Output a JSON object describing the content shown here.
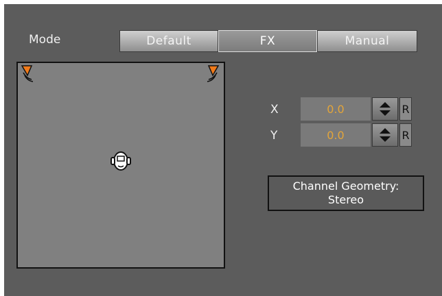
{
  "mode": {
    "label": "Mode",
    "options": [
      "Default",
      "FX",
      "Manual"
    ],
    "selected": "FX"
  },
  "position": {
    "x_label": "X",
    "x_value": "0.0",
    "y_label": "Y",
    "y_value": "0.0",
    "reset_label": "R"
  },
  "geometry": {
    "line1": "Channel Geometry:",
    "line2": "Stereo"
  },
  "icons": {
    "left_speaker": "speaker-icon",
    "right_speaker": "speaker-icon",
    "listener": "listener-head-icon",
    "stepper": "up-down-arrows-icon"
  },
  "colors": {
    "panel_bg": "#5c5c5c",
    "value_text": "#e3a53a",
    "speaker_orange": "#f07a1a"
  }
}
